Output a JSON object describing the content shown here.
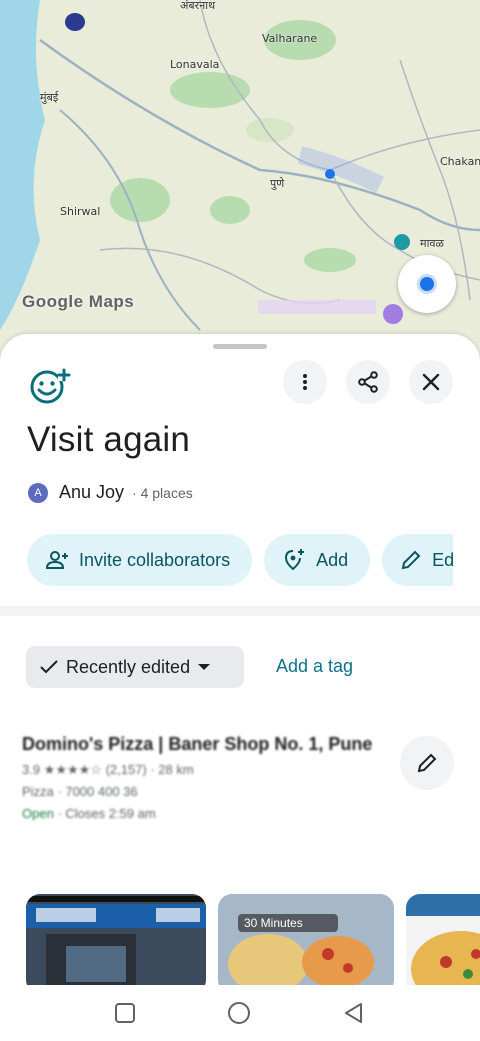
{
  "map": {
    "logo_text": "Google Maps",
    "labels": [
      "अंबरनाथ",
      "Valharane",
      "मुंबई",
      "Lonavala",
      "पुणे",
      "Shirwal",
      "Chakan",
      "मावळ"
    ],
    "colors": {
      "land": "#e8ecd9",
      "water": "#9fd7e8",
      "park": "#b7dcb0",
      "road": "#9db1c4",
      "location": "#1a73e8"
    }
  },
  "sheet": {
    "icon": "smiley-plus-icon",
    "title": "Visit again",
    "owner": {
      "initial": "A",
      "name": "Anu Joy",
      "count": "· 4 places"
    },
    "chips": [
      {
        "icon": "person-add-icon",
        "label": "Invite collaborators"
      },
      {
        "icon": "add-place-icon",
        "label": "Add"
      },
      {
        "icon": "pencil-icon",
        "label": "Edit"
      }
    ],
    "sort": {
      "label": "Recently edited"
    },
    "tag_link": "Add a tag"
  },
  "place": {
    "name": "Domino's Pizza | Baner Shop No. 1, Pune",
    "rating_line": "3.9 ★★★★☆ (2,157) · 28 km",
    "phone_line": "Pizza · 7000 400 36",
    "status_open": "Open",
    "status_close": "· Closes 2:59 am"
  },
  "photos": [
    {
      "name": "storefront-photo"
    },
    {
      "name": "food-photo",
      "caption": "30 Minutes"
    },
    {
      "name": "pizza-photo"
    }
  ],
  "accent": "#0b5563"
}
